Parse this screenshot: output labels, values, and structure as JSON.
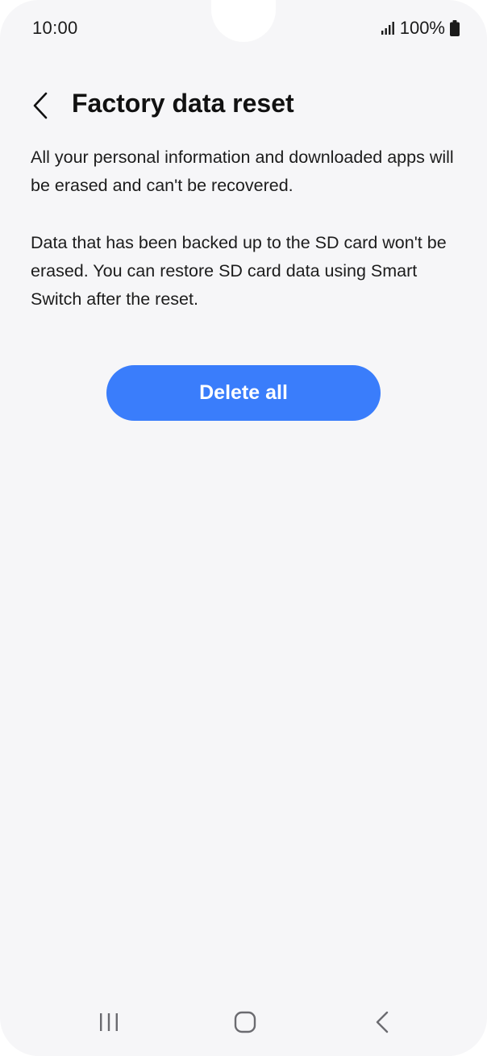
{
  "status_bar": {
    "time": "10:00",
    "battery": "100%",
    "icons": [
      "signal-icon",
      "battery-icon"
    ]
  },
  "header": {
    "back_icon": "chevron-left-icon",
    "title": "Factory data reset"
  },
  "content": {
    "paragraph1": "All your personal information and downloaded apps will be erased and can't be recovered.",
    "paragraph2": "Data that has been backed up to the SD card won't be erased. You can restore SD card data using Smart Switch after the reset."
  },
  "actions": {
    "delete_all_label": "Delete all"
  },
  "navigation_bar": {
    "icons": [
      "recents-icon",
      "home-icon",
      "back-icon"
    ]
  },
  "colors": {
    "background": "#f6f6f8",
    "primary_button": "#3a7dfb",
    "button_text": "#ffffff",
    "text": "#1c1c1c"
  }
}
